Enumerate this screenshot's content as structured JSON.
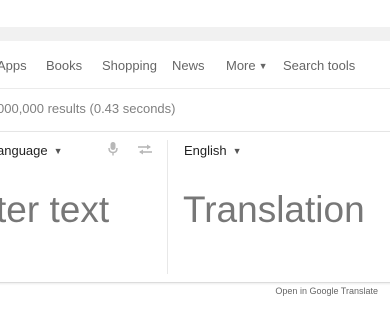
{
  "tabs": {
    "apps": "Apps",
    "books": "Books",
    "shopping": "Shopping",
    "news": "News",
    "more": "More",
    "search_tools": "Search tools"
  },
  "results_stats": "000,000 results (0.43 seconds)",
  "translate": {
    "source_language": "anguage",
    "target_language": "English",
    "source_placeholder": "ter text",
    "target_placeholder": "Translation",
    "open_link": "Open in Google Translate"
  },
  "icons": {
    "mic": "microphone-icon",
    "swap": "swap-arrows-icon"
  },
  "colors": {
    "muted_text": "#666666",
    "big_text": "#777777",
    "icon_grey": "#b8b8b8"
  }
}
